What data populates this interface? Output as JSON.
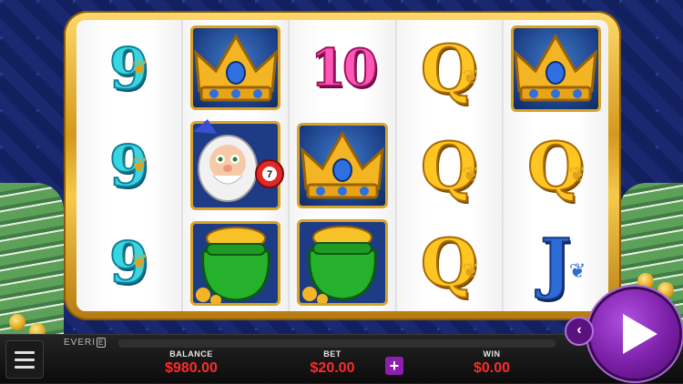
{
  "game": {
    "brand": "EVERI",
    "brand_mark": "E"
  },
  "reels": [
    [
      "nine",
      "nine",
      "nine"
    ],
    [
      "crown",
      "king",
      "pot"
    ],
    [
      "ten",
      "crown",
      "pot"
    ],
    [
      "queen",
      "queen",
      "queen"
    ],
    [
      "crown",
      "queen",
      "jack"
    ]
  ],
  "symbols": {
    "nine": "9",
    "ten": "10",
    "queen": "Q",
    "jack": "J",
    "ball": "7"
  },
  "meters": {
    "balance_label": "BALANCE",
    "balance_value": "$980.00",
    "bet_label": "BET",
    "bet_value": "$20.00",
    "win_label": "WIN",
    "win_value": "$0.00"
  },
  "controls": {
    "bet_plus": "+",
    "spin_back": "‹"
  },
  "colors": {
    "meter_value": "#ff2a2a",
    "spin": "#7b1fa8",
    "frame_gold": "#d39a1c"
  }
}
